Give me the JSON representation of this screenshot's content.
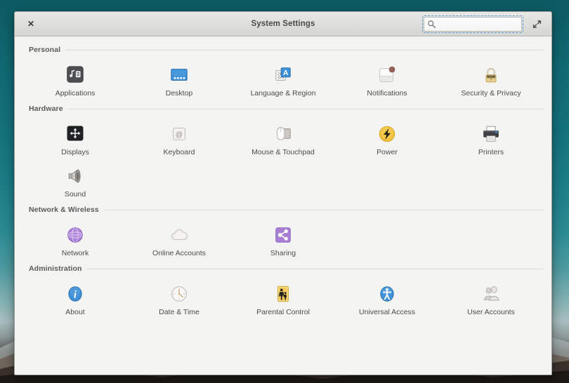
{
  "window": {
    "title": "System Settings",
    "close_label": "✕",
    "maximize_icon": "expand-diagonal-icon"
  },
  "search": {
    "value": "",
    "placeholder": "",
    "icon": "search-icon"
  },
  "sections": [
    {
      "title": "Personal",
      "items": [
        {
          "label": "Applications",
          "icon": "applications-icon"
        },
        {
          "label": "Desktop",
          "icon": "desktop-icon"
        },
        {
          "label": "Language & Region",
          "icon": "language-region-icon"
        },
        {
          "label": "Notifications",
          "icon": "notifications-icon"
        },
        {
          "label": "Security & Privacy",
          "icon": "security-privacy-icon"
        }
      ]
    },
    {
      "title": "Hardware",
      "items": [
        {
          "label": "Displays",
          "icon": "displays-icon"
        },
        {
          "label": "Keyboard",
          "icon": "keyboard-icon"
        },
        {
          "label": "Mouse & Touchpad",
          "icon": "mouse-touchpad-icon"
        },
        {
          "label": "Power",
          "icon": "power-icon"
        },
        {
          "label": "Printers",
          "icon": "printers-icon"
        },
        {
          "label": "Sound",
          "icon": "sound-icon"
        }
      ]
    },
    {
      "title": "Network & Wireless",
      "items": [
        {
          "label": "Network",
          "icon": "network-icon"
        },
        {
          "label": "Online Accounts",
          "icon": "online-accounts-icon"
        },
        {
          "label": "Sharing",
          "icon": "sharing-icon"
        }
      ]
    },
    {
      "title": "Administration",
      "items": [
        {
          "label": "About",
          "icon": "about-icon"
        },
        {
          "label": "Date & Time",
          "icon": "date-time-icon"
        },
        {
          "label": "Parental Control",
          "icon": "parental-control-icon"
        },
        {
          "label": "Universal Access",
          "icon": "universal-access-icon"
        },
        {
          "label": "User Accounts",
          "icon": "user-accounts-icon"
        }
      ]
    }
  ],
  "colors": {
    "accent_blue": "#3c8fd4",
    "power_yellow": "#f2c43d",
    "purple": "#a97fd6",
    "parental_yellow": "#f3cd60",
    "window_bg": "#f5f5f3",
    "titlebar": "#dededa",
    "desktop_teal": "#14727d"
  }
}
